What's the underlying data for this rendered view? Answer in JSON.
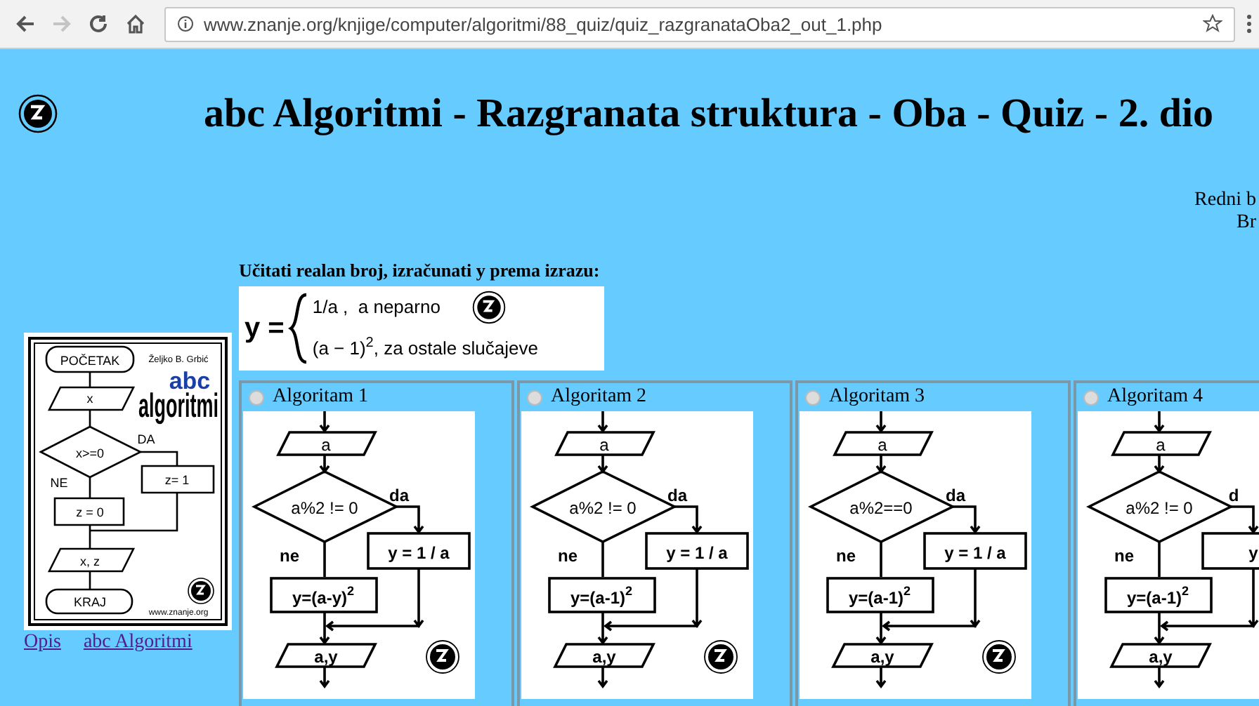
{
  "browser": {
    "url": "www.znanje.org/knjige/computer/algoritmi/88_quiz/quiz_razgranataOba2_out_1.php",
    "forward_disabled": true
  },
  "page": {
    "title": "abc Algoritmi - Razgranata struktura - Oba - Quiz - 2. dio",
    "meta": [
      "Redni b",
      "Br"
    ]
  },
  "cover": {
    "start": "POČETAK",
    "input": "x",
    "condition": "x>=0",
    "yes_label": "DA",
    "no_label": "NE",
    "yes_box": "z= 1",
    "no_box": "z = 0",
    "output": "x, z",
    "end": "KRAJ",
    "author": "Željko B. Grbić",
    "brand_top": "abc",
    "brand_bottom": "algoritmi",
    "website": "www.znanje.org"
  },
  "links": [
    "Opis",
    "abc Algoritmi"
  ],
  "question": {
    "text": "Učitati realan broj, izračunati y prema izrazu:",
    "lhs": "y =",
    "case_1": "1/a ,  a neparno",
    "case_2_base": "(a − 1)",
    "case_2_exponent": "2",
    "case_2_rest": ", za ostale slučajeve"
  },
  "algorithms": [
    {
      "label": "Algoritam 1",
      "selected": false,
      "input": "a",
      "condition": "a%2 != 0",
      "yes_label": "da",
      "no_label": "ne",
      "yes_box": "y = 1 / a",
      "no_box": "y=(a-y)",
      "no_box_exponent": "2",
      "output": "a,y"
    },
    {
      "label": "Algoritam 2",
      "selected": false,
      "input": "a",
      "condition": "a%2 != 0",
      "yes_label": "da",
      "no_label": "ne",
      "yes_box": "y = 1 / a",
      "no_box": "y=(a-1)",
      "no_box_exponent": "2",
      "output": "a,y"
    },
    {
      "label": "Algoritam 3",
      "selected": false,
      "input": "a",
      "condition": "a%2==0",
      "yes_label": "da",
      "no_label": "ne",
      "yes_box": "y = 1 / a",
      "no_box": "y=(a-1)",
      "no_box_exponent": "2",
      "output": "a,y"
    },
    {
      "label": "Algoritam 4",
      "selected": false,
      "input": "a",
      "condition": "a%2 != 0",
      "yes_label": "d",
      "no_label": "ne",
      "yes_box": "y",
      "no_box": "y=(a-1)",
      "no_box_exponent": "2",
      "output": "a,y"
    }
  ]
}
